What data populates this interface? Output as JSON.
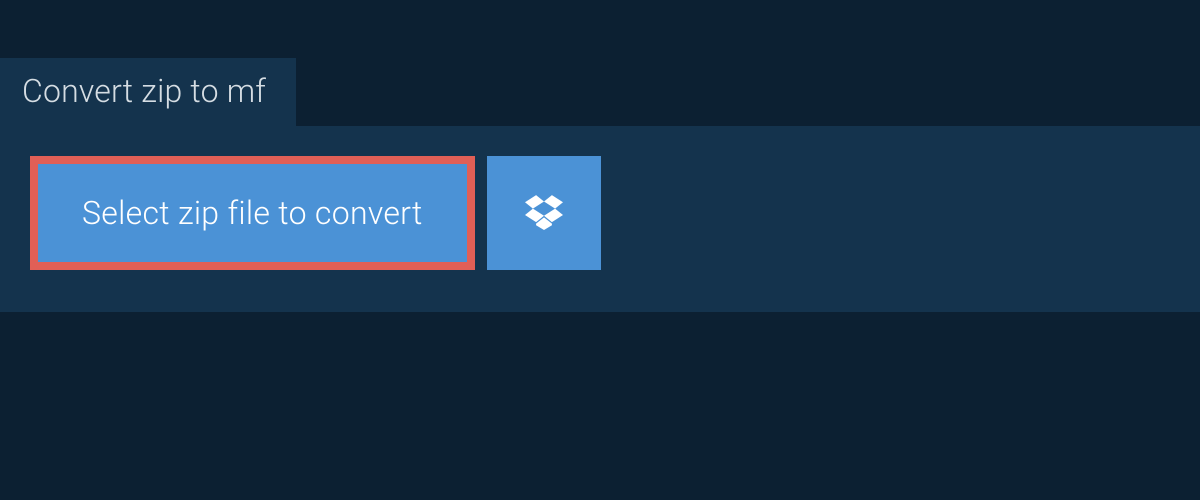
{
  "tab": {
    "title": "Convert zip to mf"
  },
  "panel": {
    "select_button_label": "Select zip file to convert"
  },
  "colors": {
    "page_bg": "#0c2032",
    "panel_bg": "#14334d",
    "button_bg": "#4b92d6",
    "highlight_border": "#e15f56",
    "text_light": "#d5dde3",
    "text_white": "#ffffff"
  }
}
